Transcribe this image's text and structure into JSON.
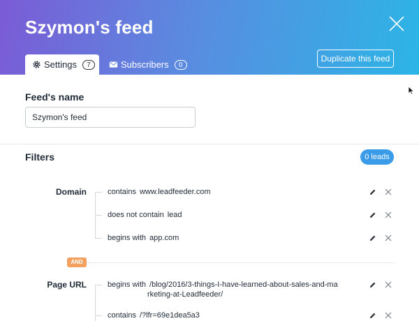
{
  "header": {
    "title": "Szymon's feed",
    "duplicate_label": "Duplicate this feed",
    "close_icon": "close-icon"
  },
  "tabs": [
    {
      "label": "Settings",
      "count": "7",
      "icon": "gear-icon",
      "active": true
    },
    {
      "label": "Subscribers",
      "count": "0",
      "icon": "envelope-icon",
      "active": false
    }
  ],
  "feed_name": {
    "heading": "Feed's name",
    "value": "Szymon's feed"
  },
  "filters": {
    "heading": "Filters",
    "leads_badge": "0 leads",
    "connector": "AND",
    "groups": [
      {
        "label": "Domain",
        "rows": [
          {
            "operator": "contains",
            "value": "www.leadfeeder.com"
          },
          {
            "operator": "does not contain",
            "value": "lead"
          },
          {
            "operator": "begins with",
            "value": "app.com"
          }
        ]
      },
      {
        "label": "Page URL",
        "rows": [
          {
            "operator": "begins with",
            "value": "/blog/2016/3-things-I-have-learned-about-sales-and-ma",
            "value_cont": "rketing-at-Leadfeeder/"
          },
          {
            "operator": "contains",
            "value": "/?lfr=69e1dea5a3"
          }
        ]
      }
    ]
  },
  "colors": {
    "gradient_start": "#7b5bd6",
    "gradient_end": "#2cb5e6",
    "leads_badge": "#3a9be8",
    "and_badge": "#f3a161"
  }
}
